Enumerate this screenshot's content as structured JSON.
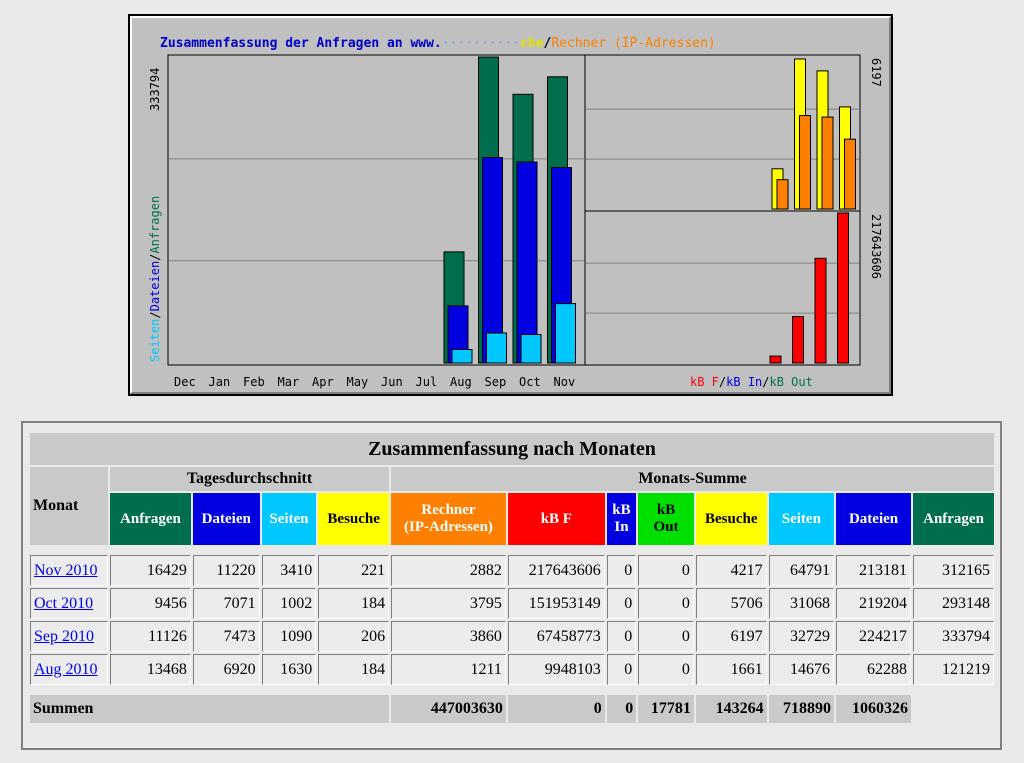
{
  "graph": {
    "title_prefix": "Zusammenfassung der Anfragen an www.",
    "title_suffix_besuche": "che",
    "title_slash": "/",
    "title_rechner": "Rechner (IP-Adressen)",
    "left_axis_max": "333794",
    "left_axis_label_seiten": "Seiten",
    "left_axis_label_dateien": "Dateien",
    "left_axis_label_anfragen": "Anfragen",
    "right_top_axis_max": "6197",
    "right_bottom_axis_max": "217643606",
    "months": [
      "Dec",
      "Jan",
      "Feb",
      "Mar",
      "Apr",
      "May",
      "Jun",
      "Jul",
      "Aug",
      "Sep",
      "Oct",
      "Nov"
    ],
    "legend_kbf": "kB F",
    "legend_kbin": "kB In",
    "legend_kbout": "kB Out",
    "legend_slash": "/"
  },
  "chart_data": [
    {
      "type": "bar",
      "categories": [
        "Dec",
        "Jan",
        "Feb",
        "Mar",
        "Apr",
        "May",
        "Jun",
        "Jul",
        "Aug",
        "Sep",
        "Oct",
        "Nov"
      ],
      "ylim": [
        0,
        333794
      ],
      "series": [
        {
          "name": "Anfragen",
          "values": [
            0,
            0,
            0,
            0,
            0,
            0,
            0,
            0,
            121219,
            333794,
            293148,
            312165
          ]
        },
        {
          "name": "Dateien",
          "values": [
            0,
            0,
            0,
            0,
            0,
            0,
            0,
            0,
            62288,
            224217,
            219204,
            213181
          ]
        },
        {
          "name": "Seiten",
          "values": [
            0,
            0,
            0,
            0,
            0,
            0,
            0,
            0,
            14676,
            32729,
            31068,
            64791
          ]
        }
      ]
    },
    {
      "type": "bar",
      "categories": [
        "Aug",
        "Sep",
        "Oct",
        "Nov"
      ],
      "ylim": [
        0,
        6197
      ],
      "series": [
        {
          "name": "Besuche",
          "values": [
            1661,
            6197,
            5706,
            4217
          ]
        },
        {
          "name": "Rechner (IP-Adressen)",
          "values": [
            1211,
            3860,
            3795,
            2882
          ]
        }
      ]
    },
    {
      "type": "bar",
      "categories": [
        "Aug",
        "Sep",
        "Oct",
        "Nov"
      ],
      "ylim": [
        0,
        217643606
      ],
      "series": [
        {
          "name": "kB F",
          "values": [
            9948103,
            67458773,
            151953149,
            217643606
          ]
        },
        {
          "name": "kB In",
          "values": [
            0,
            0,
            0,
            0
          ]
        },
        {
          "name": "kB Out",
          "values": [
            0,
            0,
            0,
            0
          ]
        }
      ]
    }
  ],
  "colors": {
    "anfragen": "#006e4c",
    "dateien": "#0000e0",
    "seiten": "#00c8ff",
    "besuche": "#ffff00",
    "rechner": "#ff8000",
    "kbf": "#ff0000",
    "kbin": "#0000e0",
    "kbout": "#00e000"
  },
  "table": {
    "title": "Zusammenfassung nach Monaten",
    "group_daily": "Tagesdurchschnitt",
    "group_monthly": "Monats-Summe",
    "col_monat": "Monat",
    "col_anfragen": "Anfragen",
    "col_dateien": "Dateien",
    "col_seiten": "Seiten",
    "col_besuche": "Besuche",
    "col_rechner_1": "Rechner",
    "col_rechner_2": "(IP-Adressen)",
    "col_kbf": "kB F",
    "col_kbin_1": "kB",
    "col_kbin_2": "In",
    "col_kbout_1": "kB",
    "col_kbout_2": "Out",
    "rows": [
      {
        "month": "Nov 2010",
        "d_anf": "16429",
        "d_dat": "11220",
        "d_sei": "3410",
        "d_bes": "221",
        "rechner": "2882",
        "kbf": "217643606",
        "kbin": "0",
        "kbout": "0",
        "besuche": "4217",
        "seiten": "64791",
        "dateien": "213181",
        "anfragen": "312165"
      },
      {
        "month": "Oct 2010",
        "d_anf": "9456",
        "d_dat": "7071",
        "d_sei": "1002",
        "d_bes": "184",
        "rechner": "3795",
        "kbf": "151953149",
        "kbin": "0",
        "kbout": "0",
        "besuche": "5706",
        "seiten": "31068",
        "dateien": "219204",
        "anfragen": "293148"
      },
      {
        "month": "Sep 2010",
        "d_anf": "11126",
        "d_dat": "7473",
        "d_sei": "1090",
        "d_bes": "206",
        "rechner": "3860",
        "kbf": "67458773",
        "kbin": "0",
        "kbout": "0",
        "besuche": "6197",
        "seiten": "32729",
        "dateien": "224217",
        "anfragen": "333794"
      },
      {
        "month": "Aug 2010",
        "d_anf": "13468",
        "d_dat": "6920",
        "d_sei": "1630",
        "d_bes": "184",
        "rechner": "1211",
        "kbf": "9948103",
        "kbin": "0",
        "kbout": "0",
        "besuche": "1661",
        "seiten": "14676",
        "dateien": "62288",
        "anfragen": "121219"
      }
    ],
    "sum": {
      "label": "Summen",
      "kbf": "447003630",
      "kbin": "0",
      "kbout": "0",
      "besuche": "17781",
      "seiten": "143264",
      "dateien": "718890",
      "anfragen": "1060326"
    }
  }
}
